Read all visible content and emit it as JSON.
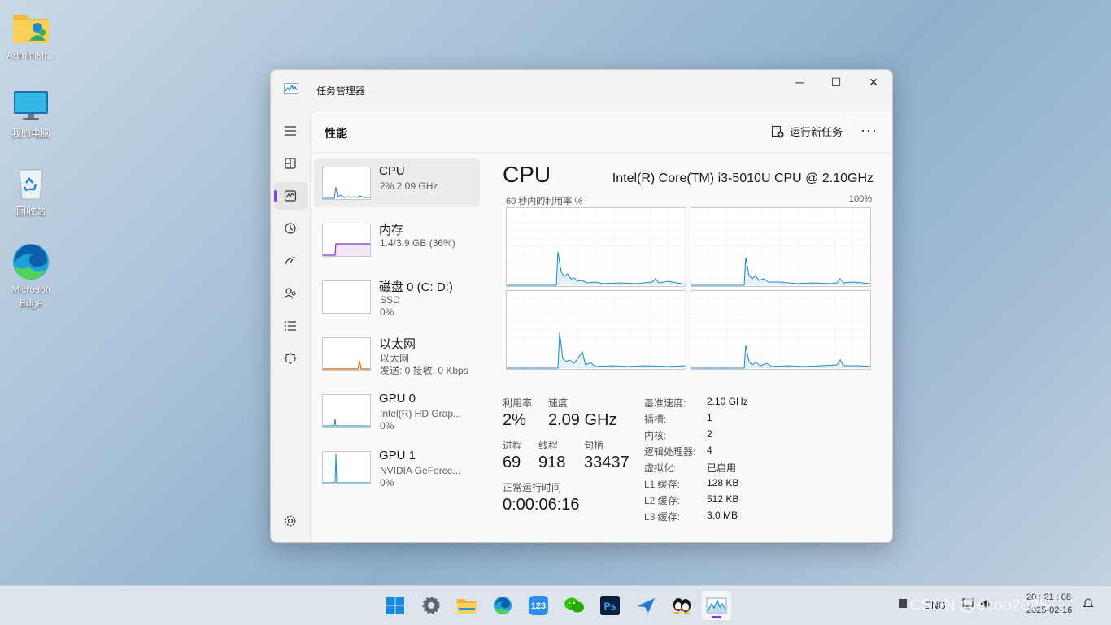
{
  "desktop": {
    "icons": [
      {
        "label": "Administr..."
      },
      {
        "label": "我的电脑"
      },
      {
        "label": "回收站"
      },
      {
        "label": "Microsoft Edge"
      }
    ]
  },
  "window": {
    "title": "任务管理器",
    "buttons": {
      "minimize": "─",
      "maximize": "☐",
      "close": "✕"
    }
  },
  "nav": {
    "items": [
      "hamburger-icon",
      "processes-icon",
      "performance-icon",
      "app-history-icon",
      "startup-icon",
      "users-icon",
      "details-icon",
      "services-icon"
    ],
    "settings": "gear-icon"
  },
  "header": {
    "title": "性能",
    "run_new_task": "运行新任务",
    "more": "···"
  },
  "resources": [
    {
      "name": "CPU",
      "sub1": "2% 2.09 GHz",
      "sub2": ""
    },
    {
      "name": "内存",
      "sub1": "1.4/3.9 GB (36%)",
      "sub2": ""
    },
    {
      "name": "磁盘 0 (C: D:)",
      "sub1": "SSD",
      "sub2": "0%"
    },
    {
      "name": "以太网",
      "sub1": "以太网",
      "sub2": "发送: 0 接收: 0 Kbps"
    },
    {
      "name": "GPU 0",
      "sub1": "Intel(R) HD Grap...",
      "sub2": "0%"
    },
    {
      "name": "GPU 1",
      "sub1": "NVIDIA GeForce...",
      "sub2": "0%"
    }
  ],
  "cpu": {
    "title": "CPU",
    "model": "Intel(R) Core(TM) i3-5010U CPU @ 2.10GHz",
    "graph_label": "60 秒内的利用率 %",
    "graph_max": "100%",
    "stats": {
      "utilization_label": "利用率",
      "utilization": "2%",
      "speed_label": "速度",
      "speed": "2.09 GHz",
      "processes_label": "进程",
      "processes": "69",
      "threads_label": "线程",
      "threads": "918",
      "handles_label": "句柄",
      "handles": "33437",
      "uptime_label": "正常运行时间",
      "uptime": "0:00:06:16"
    },
    "specs": [
      {
        "k": "基准速度:",
        "v": "2.10 GHz"
      },
      {
        "k": "插槽:",
        "v": "1"
      },
      {
        "k": "内核:",
        "v": "2"
      },
      {
        "k": "逻辑处理器:",
        "v": "4"
      },
      {
        "k": "虚拟化:",
        "v": "已启用"
      },
      {
        "k": "L1 缓存:",
        "v": "128 KB"
      },
      {
        "k": "L2 缓存:",
        "v": "512 KB"
      },
      {
        "k": "L3 缓存:",
        "v": "3.0 MB"
      }
    ]
  },
  "taskbar": {
    "apps": [
      "start-icon",
      "settings-icon",
      "file-explorer-icon",
      "edge-icon",
      "app-123-icon",
      "wechat-icon",
      "photoshop-icon",
      "feishu-icon",
      "qq-icon",
      "task-manager-icon"
    ],
    "app_123_label": "123",
    "ps_label": "Ps",
    "lang": "ENG",
    "time": "20 : 21 : 08",
    "date": "2025-02-16",
    "watermark": "CSDN @ecoo2025"
  },
  "colors": {
    "accent": "#7f3ff2",
    "cpu_line": "#1a8ac6",
    "memory_line": "#8b2bbf",
    "ethernet_line": "#c8691e"
  }
}
